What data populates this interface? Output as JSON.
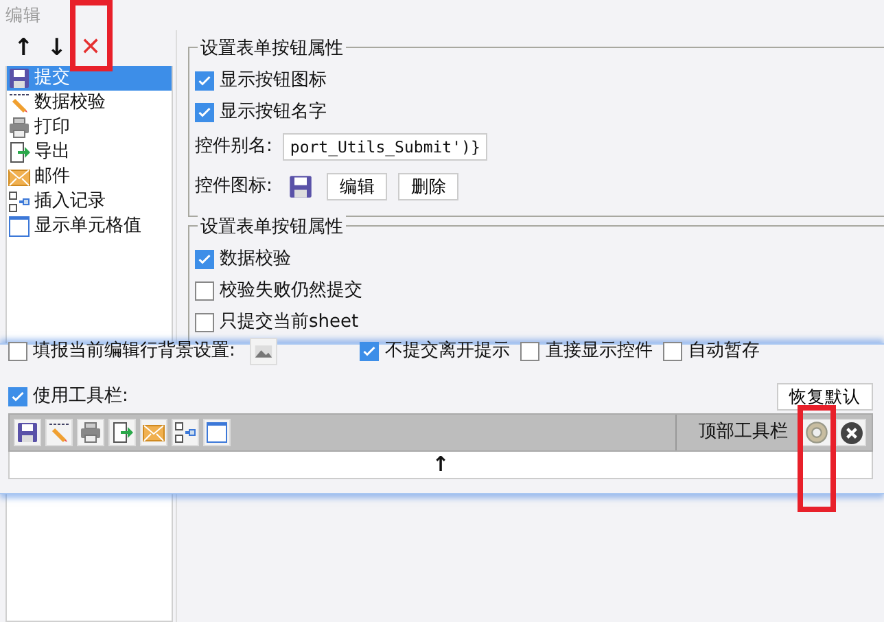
{
  "window": {
    "title": "编辑"
  },
  "list_toolbar": [
    {
      "kind": "up",
      "label": "↑",
      "highlighted": false
    },
    {
      "kind": "down",
      "label": "↓",
      "highlighted": false
    },
    {
      "kind": "delete",
      "label": "✕",
      "highlighted": true
    }
  ],
  "button_list": [
    {
      "kind": "save",
      "label": "提交",
      "selected": true
    },
    {
      "kind": "check",
      "label": "数据校验",
      "selected": false
    },
    {
      "kind": "print",
      "label": "打印",
      "selected": false
    },
    {
      "kind": "export",
      "label": "导出",
      "selected": false
    },
    {
      "kind": "mail",
      "label": "邮件",
      "selected": false
    },
    {
      "kind": "insert",
      "label": "插入记录",
      "selected": false
    },
    {
      "kind": "cell",
      "label": "显示单元格值",
      "selected": false
    }
  ],
  "button_props": {
    "title": "设置表单按钮属性",
    "options": [
      {
        "label": "显示按钮图标",
        "checked": true
      },
      {
        "label": "显示按钮名字",
        "checked": true
      }
    ],
    "alias_label": "控件别名:",
    "alias_value": "port_Utils_Submit')}",
    "icon_label": "控件图标:",
    "buttons": [
      "编辑",
      "删除"
    ]
  },
  "submit_props": {
    "title": "设置表单按钮属性",
    "options": [
      {
        "label": "数据校验",
        "checked": true
      },
      {
        "label": "校验失败仍然提交",
        "checked": false
      },
      {
        "label": "只提交当前sheet",
        "checked": false
      }
    ]
  },
  "overlay": {
    "row_options": [
      {
        "kind": "image",
        "label": "填报当前编辑行背景设置:",
        "checked": false
      },
      {
        "kind": "plain",
        "label": "不提交离开提示",
        "checked": true
      },
      {
        "kind": "plain",
        "label": "直接显示控件",
        "checked": false
      },
      {
        "kind": "plain",
        "label": "自动暂存",
        "checked": false
      }
    ],
    "toolbar_toggle": {
      "label": "使用工具栏:",
      "checked": true
    },
    "reset_button": "恢复默认",
    "toolbar_icons": [
      {
        "kind": "save"
      },
      {
        "kind": "check"
      },
      {
        "kind": "print"
      },
      {
        "kind": "export"
      },
      {
        "kind": "mail"
      },
      {
        "kind": "insert"
      },
      {
        "kind": "cell"
      }
    ],
    "position_label": "顶部工具栏",
    "settings_highlighted": true,
    "arrow": "↑"
  }
}
